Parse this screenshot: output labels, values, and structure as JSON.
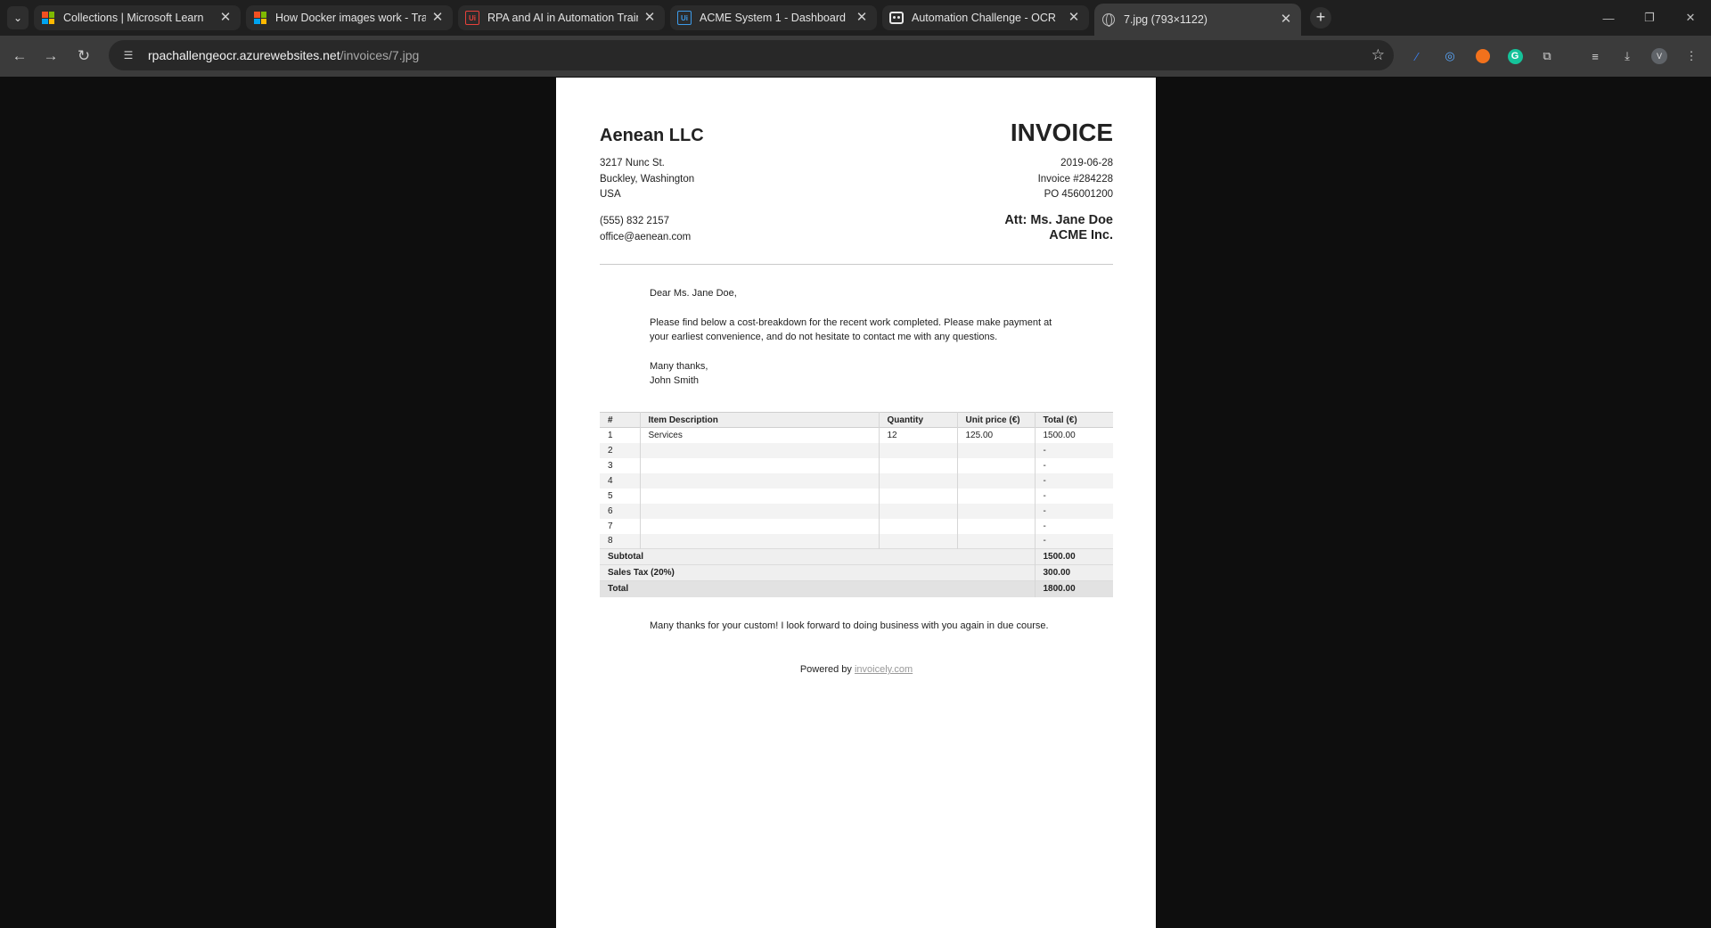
{
  "browser": {
    "tabs": [
      {
        "title": "Collections | Microsoft Learn",
        "icon": "microsoft-icon"
      },
      {
        "title": "How Docker images work - Trai",
        "icon": "microsoft-icon"
      },
      {
        "title": "RPA and AI in Automation Train",
        "icon": "uipath-icon"
      },
      {
        "title": "ACME System 1 - Dashboard",
        "icon": "uipath-icon"
      },
      {
        "title": "Automation Challenge - OCR",
        "icon": "robot-icon"
      },
      {
        "title": "7.jpg (793×1122)",
        "icon": "globe-icon",
        "active": true
      }
    ],
    "url_host": "rpachallengeocr.azurewebsites.net",
    "url_path": "/invoices/7.jpg",
    "profile_initial": "V"
  },
  "invoice": {
    "company": "Aenean LLC",
    "title": "INVOICE",
    "address": [
      "3217 Nunc St.",
      "Buckley, Washington",
      "USA"
    ],
    "phone": "(555) 832 2157",
    "email": "office@aenean.com",
    "date": "2019-06-28",
    "number": "Invoice #284228",
    "po": "PO 456001200",
    "att_name": "Att: Ms. Jane Doe",
    "att_company": "ACME Inc.",
    "greeting": "Dear Ms. Jane Doe,",
    "body": "Please find below a cost-breakdown for the recent work completed. Please make payment at your earliest convenience, and do not hesitate to contact me with any questions.",
    "thanks": "Many thanks,",
    "signature": "John Smith",
    "table": {
      "headers": [
        "#",
        "Item Description",
        "Quantity",
        "Unit price (€)",
        "Total (€)"
      ],
      "rows": [
        [
          "1",
          "Services",
          "12",
          "125.00",
          "1500.00"
        ],
        [
          "2",
          "",
          "",
          "",
          "-"
        ],
        [
          "3",
          "",
          "",
          "",
          "-"
        ],
        [
          "4",
          "",
          "",
          "",
          "-"
        ],
        [
          "5",
          "",
          "",
          "",
          "-"
        ],
        [
          "6",
          "",
          "",
          "",
          "-"
        ],
        [
          "7",
          "",
          "",
          "",
          "-"
        ],
        [
          "8",
          "",
          "",
          "",
          "-"
        ]
      ],
      "subtotal_label": "Subtotal",
      "subtotal": "1500.00",
      "tax_label": "Sales Tax (20%)",
      "tax": "300.00",
      "total_label": "Total",
      "total": "1800.00"
    },
    "closing": "Many thanks for your custom! I look forward to doing business with you again in due course.",
    "powered_prefix": "Powered by ",
    "powered_link": "invoicely.com"
  }
}
